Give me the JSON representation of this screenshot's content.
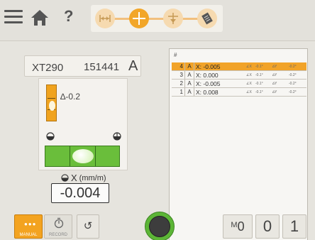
{
  "toolbar": {
    "help_label": "?",
    "steps": [
      {
        "name": "distance-step",
        "icon": "distance-icon",
        "active": false
      },
      {
        "name": "measure-step",
        "icon": "crosshair-icon",
        "active": true
      },
      {
        "name": "adjust-step",
        "icon": "adjust-icon",
        "active": false
      },
      {
        "name": "report-step",
        "icon": "report-icon",
        "active": false
      }
    ]
  },
  "sensor": {
    "model": "XT290",
    "serial": "151441",
    "unit_letter": "A"
  },
  "level": {
    "vertical_delta": "∆-0.2",
    "unit_axis": "X",
    "unit": "(mm/m)",
    "value": "-0.004"
  },
  "table": {
    "header": "#",
    "rows": [
      {
        "index": "4",
        "letter": "A",
        "x_value": "X: -0.005",
        "ang_x": "∠X",
        "ang_x_val": "-0.1°",
        "ang_y": "∆Y",
        "ang_y_val": "-0.2°",
        "selected": true
      },
      {
        "index": "3",
        "letter": "A",
        "x_value": "X: 0.000",
        "ang_x": "∠X",
        "ang_x_val": "-0.1°",
        "ang_y": "∆Y",
        "ang_y_val": "-0.2°",
        "selected": false
      },
      {
        "index": "2",
        "letter": "A",
        "x_value": "X: -0.005",
        "ang_x": "∠X",
        "ang_x_val": "-0.1°",
        "ang_y": "∆Y",
        "ang_y_val": "-0.2°",
        "selected": false
      },
      {
        "index": "1",
        "letter": "A",
        "x_value": "X: 0.008",
        "ang_x": "∠X",
        "ang_x_val": "-0.1°",
        "ang_y": "∆Y",
        "ang_y_val": "-0.2°",
        "selected": false
      }
    ]
  },
  "bottom": {
    "manual_label": "MANUAL",
    "record_label": "RECORD",
    "undo_symbol": "↺",
    "memory_symbol": "M",
    "memory_value": "0",
    "count_a": "0",
    "count_b": "1"
  },
  "colors": {
    "accent": "#f2a629",
    "level_green": "#6abe3b",
    "selected_row": "#f1a329"
  }
}
